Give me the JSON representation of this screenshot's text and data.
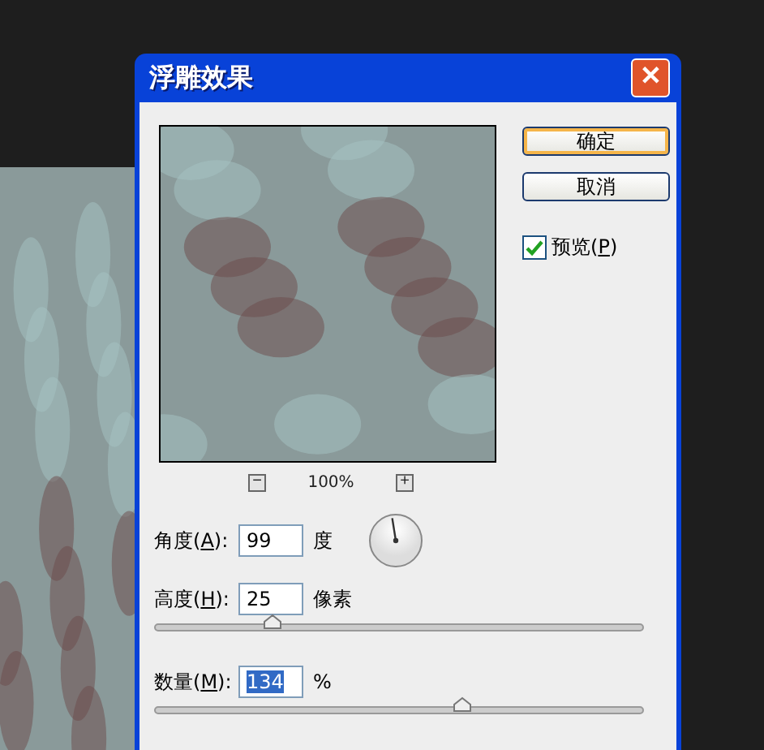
{
  "dialog": {
    "title": "浮雕效果",
    "close": "✕"
  },
  "preview": {
    "kind": "picture",
    "zoom_out": "−",
    "zoom": "100%",
    "zoom_in": "+"
  },
  "buttons": [
    {
      "label": "确定",
      "focused": true
    },
    {
      "label": "取消",
      "focused": false
    }
  ],
  "preview_checkbox": {
    "before": "预览(",
    "accel": "P",
    "after": ")",
    "checked": true
  },
  "fields": [
    {
      "kind": "dial",
      "before": "角度(",
      "accel": "A",
      "after": "):",
      "value": "99",
      "unit": "度",
      "selected": false
    },
    {
      "kind": "slider",
      "before": "高度(",
      "accel": "H",
      "after": "):",
      "value": "25",
      "unit": "像素",
      "level": 0.24,
      "selected": false
    },
    {
      "kind": "slider",
      "before": "数量(",
      "accel": "M",
      "after": "):",
      "value": "134",
      "unit": "%",
      "level": 0.63,
      "selected": true
    }
  ]
}
